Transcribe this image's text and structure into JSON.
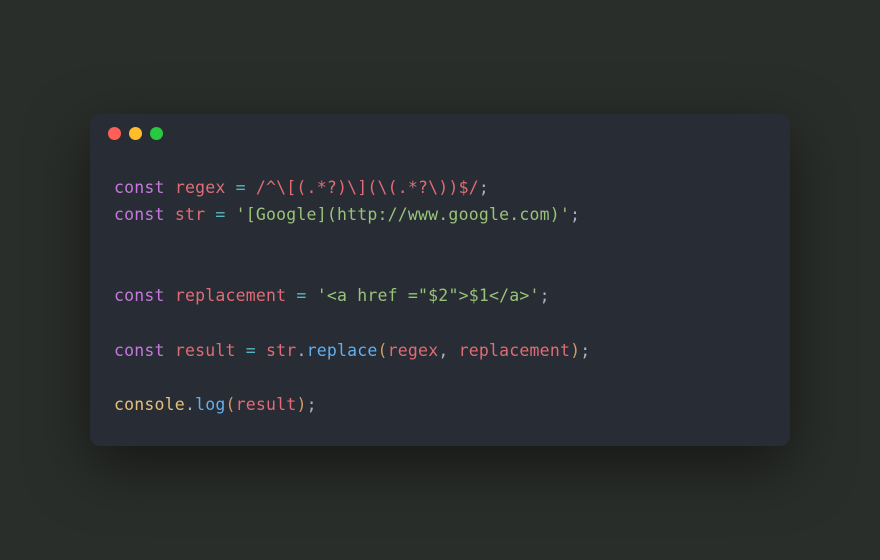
{
  "traffic_lights": [
    "red",
    "yellow",
    "green"
  ],
  "code": {
    "line1": {
      "kw": "const",
      "var": "regex",
      "op": " = ",
      "regex": "/^\\[(.*?)\\](\\(.*?\\))$/",
      "end": ";"
    },
    "line2": {
      "kw": "const",
      "var": "str",
      "op": " = ",
      "str": "'[Google](http://www.google.com)'",
      "end": ";"
    },
    "line3": {
      "kw": "const",
      "var": "replacement",
      "op": " = ",
      "str": "'<a href =\"$2\">$1</a>'",
      "end": ";"
    },
    "line4": {
      "kw": "const",
      "var": "result",
      "op1": " = ",
      "obj": "str",
      "dot": ".",
      "fn": "replace",
      "p1": "(",
      "arg1": "regex",
      "comma": ", ",
      "arg2": "replacement",
      "p2": ")",
      "end": ";"
    },
    "line5": {
      "obj": "console",
      "dot": ".",
      "fn": "log",
      "p1": "(",
      "arg": "result",
      "p2": ")",
      "end": ";"
    }
  }
}
